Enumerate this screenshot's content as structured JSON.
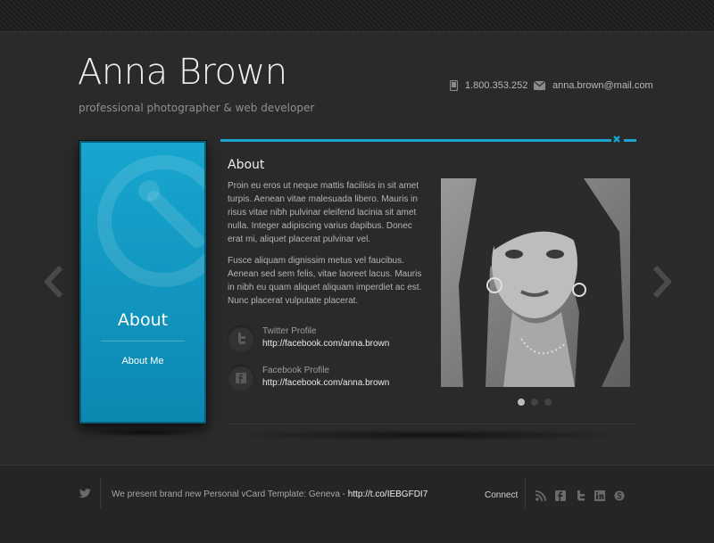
{
  "header": {
    "name": "Anna Brown",
    "tagline": "professional photographer & web developer",
    "phone": "1.800.353.252",
    "email": "anna.brown@mail.com"
  },
  "card": {
    "title": "About",
    "link": "About Me",
    "icon": "clock-icon"
  },
  "about": {
    "title": "About",
    "paragraph1": "Proin eu eros ut neque mattis facilisis in sit amet turpis. Aenean vitae malesuada libero. Mauris in risus vitae nibh pulvinar eleifend lacinia sit amet nulla. Integer adipiscing varius dapibus. Donec erat mi, aliquet placerat pulvinar vel.",
    "paragraph2": "Fusce aliquam dignissim metus vel faucibus. Aenean sed sem felis, vitae laoreet lacus. Mauris in nibh eu quam aliquet aliquam imperdiet ac est. Nunc placerat vulputate placerat.",
    "profiles": [
      {
        "label": "Twitter Profile",
        "url": "http://facebook.com/anna.brown",
        "icon": "twitter-icon"
      },
      {
        "label": "Facebook Profile",
        "url": "http://facebook.com/anna.brown",
        "icon": "facebook-icon"
      }
    ]
  },
  "slider": {
    "dots": 3,
    "active_index": 0
  },
  "footer": {
    "tweet_text": "We present brand new Personal vCard Template: Geneva - ",
    "tweet_link": "http://t.co/IEBGFDI7",
    "connect_label": "Connect",
    "social_icons": [
      "rss-icon",
      "facebook-icon",
      "twitter-icon",
      "linkedin-icon",
      "skype-icon"
    ]
  },
  "colors": {
    "accent": "#1aa3cf",
    "background": "#2a2a2a",
    "card": "#17a6cf"
  }
}
